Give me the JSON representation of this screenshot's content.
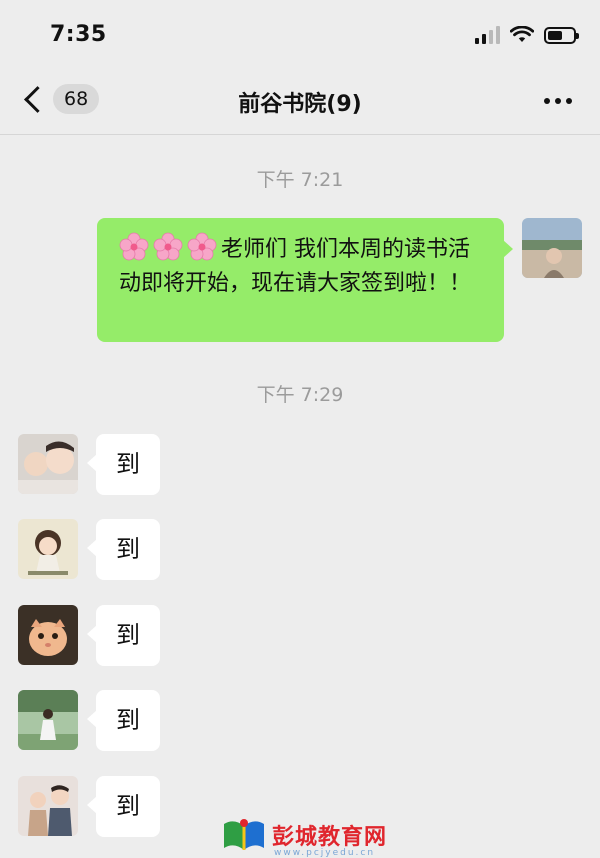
{
  "status_bar": {
    "time": "7:35"
  },
  "nav": {
    "unread_count": "68",
    "title": "前谷书院(9)"
  },
  "messages": {
    "timestamp_1": "下午 7:21",
    "outgoing_text": "老师们 我们本周的读书活动即将开始，现在请大家签到啦！！",
    "timestamp_2": "下午 7:29",
    "replies": [
      "到",
      "到",
      "到",
      "到",
      "到"
    ]
  },
  "watermark": {
    "text": "彭城教育网",
    "sub": "www.pcjyedu.cn"
  },
  "colors": {
    "background": "#ededed",
    "outgoing_bubble": "#95ec69",
    "incoming_bubble": "#ffffff",
    "timestamp": "#9b9b9b",
    "watermark": "#e0262d"
  }
}
